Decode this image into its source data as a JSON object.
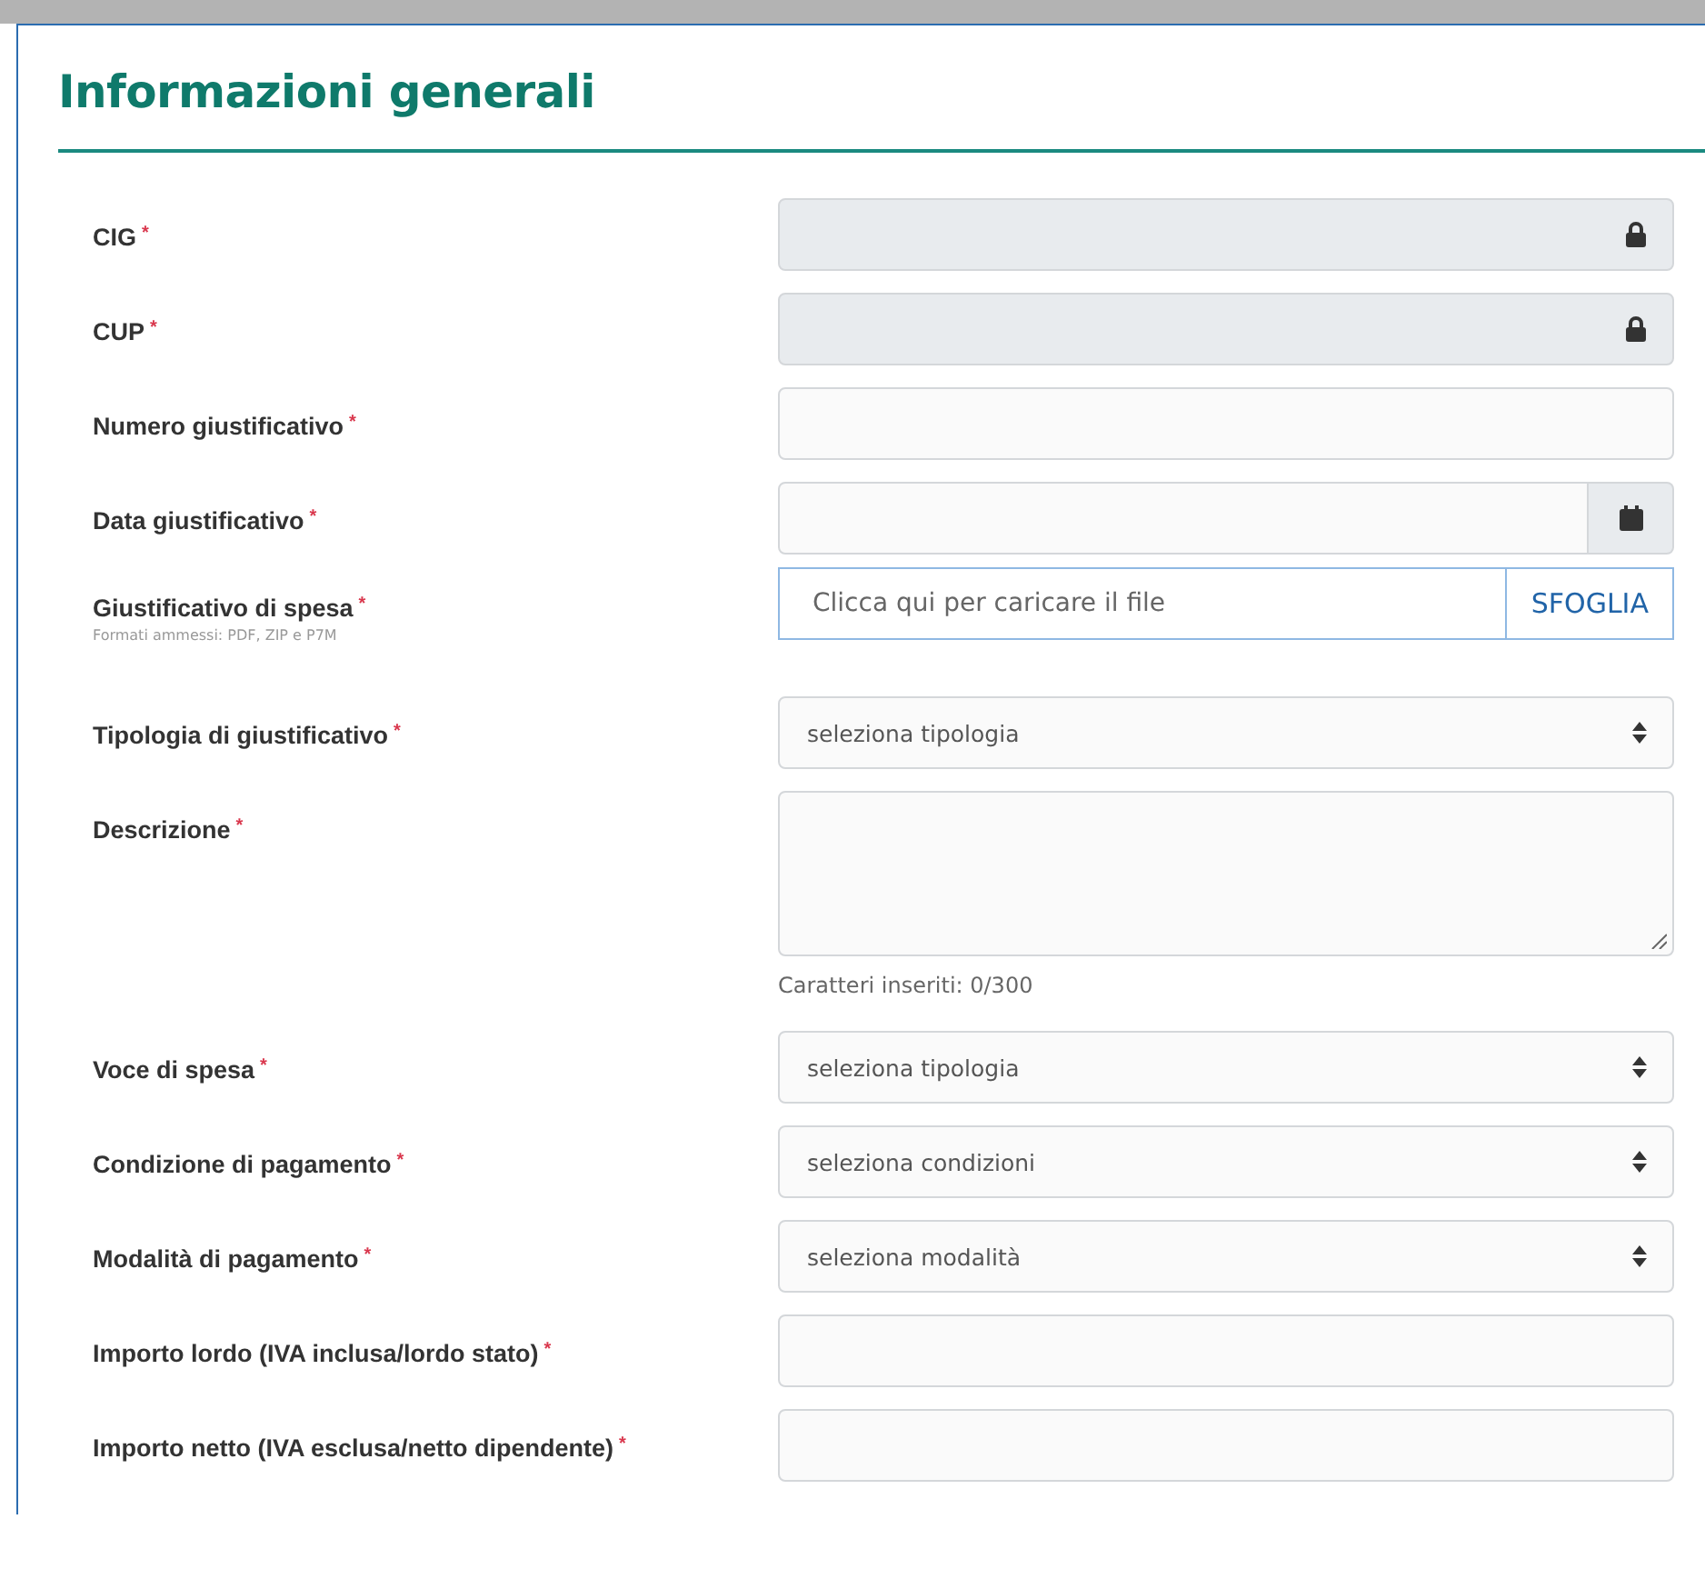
{
  "section": {
    "title": "Informazioni generali"
  },
  "fields": [
    {
      "kind": "locked",
      "label": "CIG",
      "required_mark": "*"
    },
    {
      "kind": "locked",
      "label": "CUP",
      "required_mark": "*"
    },
    {
      "kind": "text",
      "label": "Numero giustificativo",
      "required_mark": "*"
    },
    {
      "kind": "date",
      "label": "Data giustificativo",
      "required_mark": "*"
    },
    {
      "kind": "file",
      "label": "Giustificativo di spesa",
      "required_mark": "*",
      "hint": "Formati ammessi: PDF, ZIP e P7M",
      "placeholder": "Clicca qui per caricare il file",
      "button": "SFOGLIA"
    },
    {
      "kind": "select",
      "label": "Tipologia di giustificativo",
      "required_mark": "*",
      "value": "seleziona tipologia"
    },
    {
      "kind": "textarea",
      "label": "Descrizione",
      "required_mark": "*",
      "counter": "Caratteri inseriti: 0/300"
    },
    {
      "kind": "select",
      "label": "Voce di spesa",
      "required_mark": "*",
      "value": "seleziona tipologia"
    },
    {
      "kind": "select",
      "label": "Condizione di pagamento",
      "required_mark": "*",
      "value": "seleziona condizioni"
    },
    {
      "kind": "select",
      "label": "Modalità di pagamento",
      "required_mark": "*",
      "value": "seleziona modalità"
    },
    {
      "kind": "text",
      "label": "Importo lordo (IVA inclusa/lordo stato)",
      "required_mark": "*"
    },
    {
      "kind": "text",
      "label": "Importo netto (IVA esclusa/netto dipendente)",
      "required_mark": "*"
    }
  ]
}
